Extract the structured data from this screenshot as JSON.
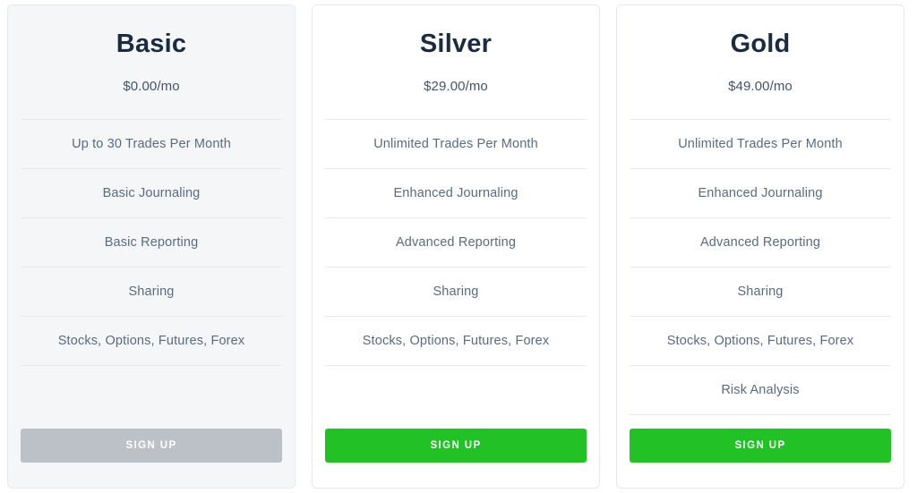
{
  "page": {
    "background": "#ffffff",
    "accent_green": "#22c227",
    "disabled_grey": "#bcc1c8",
    "title_color": "#1a2b42",
    "feature_color": "#5a6b80",
    "divider_color": "#e8ebee"
  },
  "plans": [
    {
      "id": "basic",
      "title": "Basic",
      "price": "$0.00/mo",
      "highlighted": false,
      "features": [
        "Up to 30 Trades Per Month",
        "Basic Journaling",
        "Basic Reporting",
        "Sharing",
        "Stocks, Options, Futures, Forex"
      ],
      "cta": {
        "label": "SIGN UP",
        "style": "disabled"
      }
    },
    {
      "id": "silver",
      "title": "Silver",
      "price": "$29.00/mo",
      "highlighted": true,
      "features": [
        "Unlimited Trades Per Month",
        "Enhanced Journaling",
        "Advanced Reporting",
        "Sharing",
        "Stocks, Options, Futures, Forex"
      ],
      "cta": {
        "label": "SIGN UP",
        "style": "primary"
      }
    },
    {
      "id": "gold",
      "title": "Gold",
      "price": "$49.00/mo",
      "highlighted": true,
      "features": [
        "Unlimited Trades Per Month",
        "Enhanced Journaling",
        "Advanced Reporting",
        "Sharing",
        "Stocks, Options, Futures, Forex",
        "Risk Analysis"
      ],
      "cta": {
        "label": "SIGN UP",
        "style": "primary"
      }
    }
  ]
}
